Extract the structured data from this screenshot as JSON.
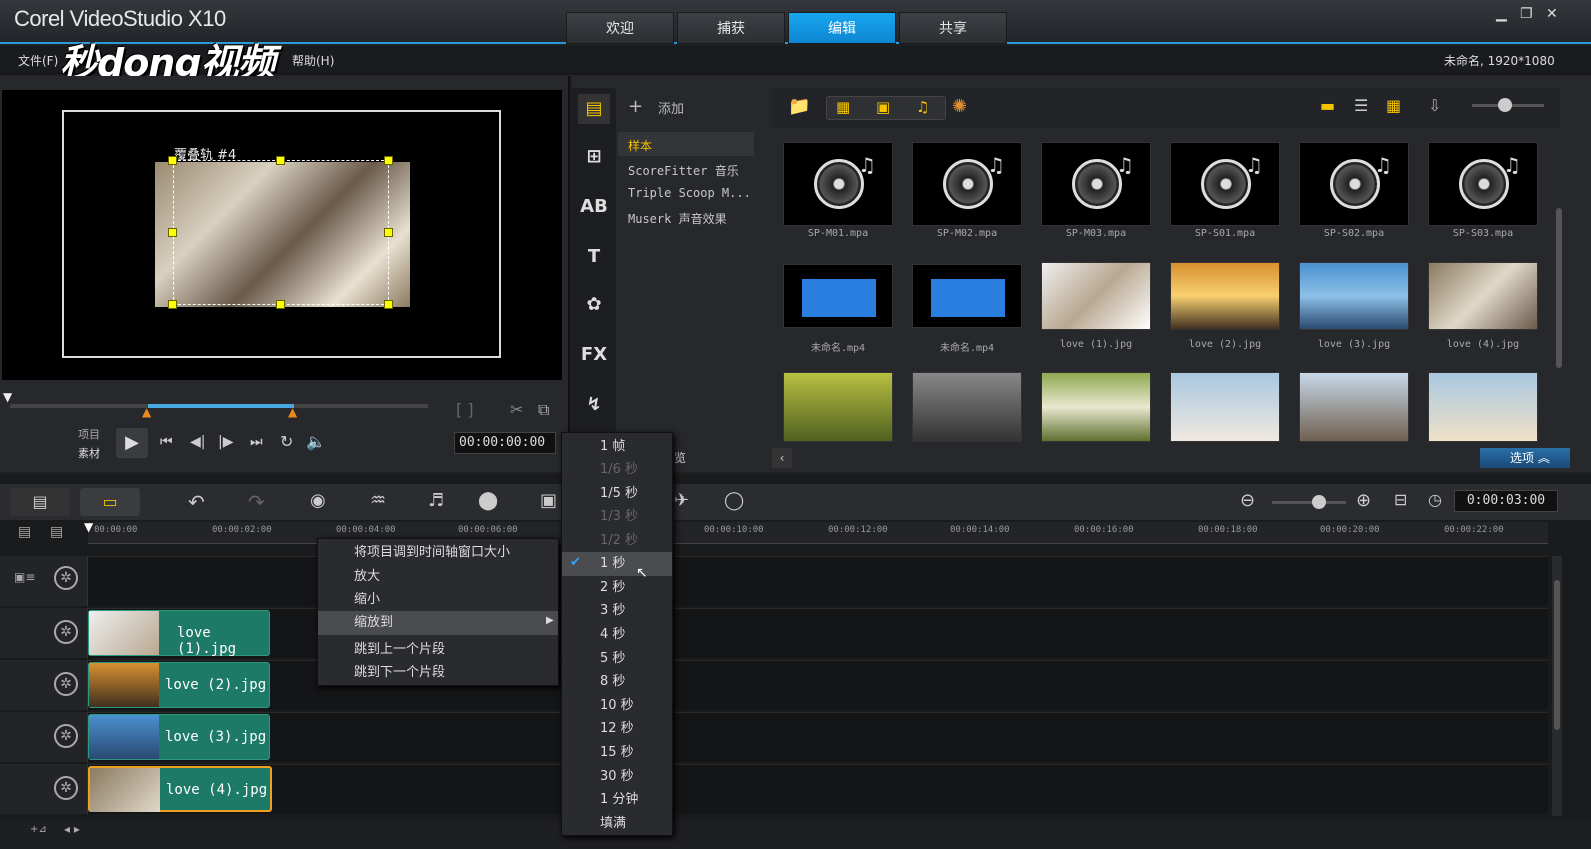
{
  "app": {
    "title": "Corel VideoStudio X10",
    "watermark": "秒dong视频",
    "project": "未命名, 1920*1080"
  },
  "tabs": [
    {
      "label": "欢迎"
    },
    {
      "label": "捕获"
    },
    {
      "label": "编辑"
    },
    {
      "label": "共享"
    }
  ],
  "menu": {
    "file": "文件(F)",
    "help": "帮助(H)"
  },
  "preview": {
    "overlay_label": "覆叠轨 #4",
    "mode_project": "项目",
    "mode_clip": "素材",
    "timecode": "00:00:00:00"
  },
  "library": {
    "add": "添加",
    "categories": [
      "样本",
      "ScoreFitter 音乐",
      "Triple Scoop M...",
      "Muserk 声音效果"
    ],
    "thumbs": [
      "SP-M01.mpa",
      "SP-M02.mpa",
      "SP-M03.mpa",
      "SP-S01.mpa",
      "SP-S02.mpa",
      "SP-S03.mpa",
      "未命名.mp4",
      "未命名.mp4",
      "love (1).jpg",
      "love (2).jpg",
      "love (3).jpg",
      "love (4).jpg"
    ],
    "options": "选项",
    "browse_suffix": "览"
  },
  "timeline": {
    "duration": "0:00:03:00",
    "ticks": [
      "00:00:00",
      "00:00:02:00",
      "00:00:04:00",
      "00:00:06:00",
      "00:00:10:00",
      "00:00:12:00",
      "00:00:14:00",
      "00:00:16:00",
      "00:00:18:00",
      "00:00:20:00",
      "00:00:22:00"
    ],
    "clips": [
      "love (1).jpg",
      "love (2).jpg",
      "love (3).jpg",
      "love (4).jpg"
    ]
  },
  "context_menu": {
    "items": [
      "将项目调到时间轴窗口大小",
      "放大",
      "缩小",
      "缩放到",
      "跳到上一个片段",
      "跳到下一个片段"
    ]
  },
  "zoom_menu": {
    "items": [
      "1 帧",
      "1/6 秒",
      "1/5 秒",
      "1/3 秒",
      "1/2 秒",
      "1 秒",
      "2 秒",
      "3 秒",
      "4 秒",
      "5 秒",
      "8 秒",
      "10 秒",
      "12 秒",
      "15 秒",
      "30 秒",
      "1 分钟",
      "填满"
    ],
    "selected": "1 秒"
  },
  "colors": {
    "accent": "#1aa3ee",
    "clip": "#1d7a66",
    "handle": "#ffff00"
  }
}
